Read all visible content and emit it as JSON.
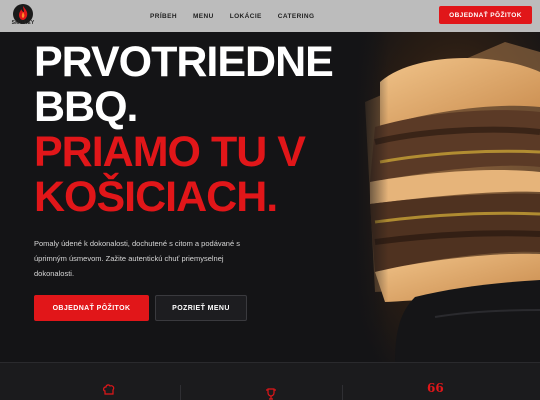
{
  "brand": {
    "logo_text": "SMOKEY",
    "icon": "flame-logo-icon",
    "accent_color": "#e11619"
  },
  "nav": {
    "links": [
      "PRÍBEH",
      "MENU",
      "LOKÁCIE",
      "CATERING"
    ],
    "cta_label": "OBJEDNAŤ PÔŽITOK"
  },
  "hero": {
    "headline_line1": "PRVOTRIEDNE",
    "headline_line2": "BBQ.",
    "headline_line3": "PRIAMO TU V",
    "headline_line4": "KOŠICIACH.",
    "lead": "Pomaly údené k dokonalosti, dochutené s citom a podávané s úprimným úsmevom. Zažite autentickú chuť priemyselnej dokonalosti.",
    "primary_button": "OBJEDNAŤ PÔŽITOK",
    "secondary_button": "POZRIEŤ MENU",
    "image": "burger-photo"
  },
  "features": {
    "icons": [
      "chef-hat-icon",
      "trophy-icon",
      "quote-icon"
    ],
    "quote_glyph": "66"
  }
}
